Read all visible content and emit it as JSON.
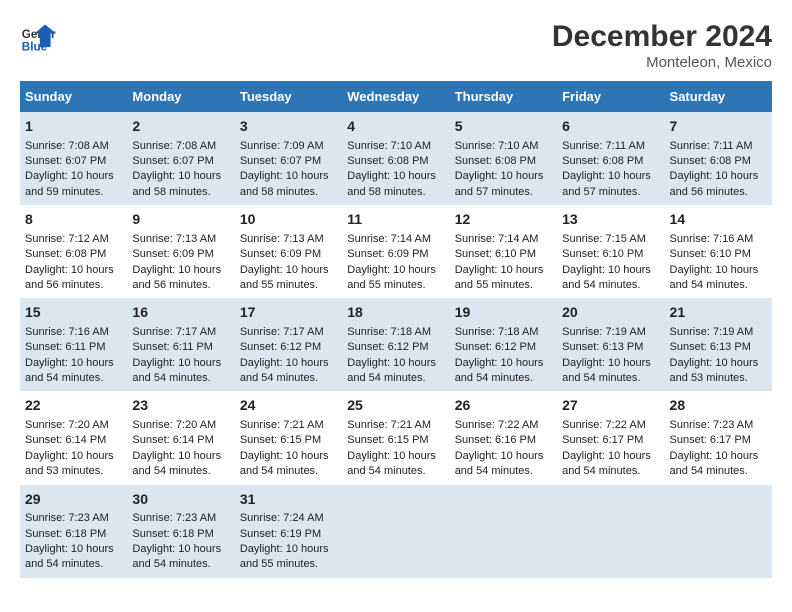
{
  "logo": {
    "line1": "General",
    "line2": "Blue"
  },
  "title": "December 2024",
  "subtitle": "Monteleon, Mexico",
  "days_header": [
    "Sunday",
    "Monday",
    "Tuesday",
    "Wednesday",
    "Thursday",
    "Friday",
    "Saturday"
  ],
  "weeks": [
    [
      {
        "day": "1",
        "sunrise": "7:08 AM",
        "sunset": "6:07 PM",
        "daylight": "10 hours and 59 minutes."
      },
      {
        "day": "2",
        "sunrise": "7:08 AM",
        "sunset": "6:07 PM",
        "daylight": "10 hours and 58 minutes."
      },
      {
        "day": "3",
        "sunrise": "7:09 AM",
        "sunset": "6:07 PM",
        "daylight": "10 hours and 58 minutes."
      },
      {
        "day": "4",
        "sunrise": "7:10 AM",
        "sunset": "6:08 PM",
        "daylight": "10 hours and 58 minutes."
      },
      {
        "day": "5",
        "sunrise": "7:10 AM",
        "sunset": "6:08 PM",
        "daylight": "10 hours and 57 minutes."
      },
      {
        "day": "6",
        "sunrise": "7:11 AM",
        "sunset": "6:08 PM",
        "daylight": "10 hours and 57 minutes."
      },
      {
        "day": "7",
        "sunrise": "7:11 AM",
        "sunset": "6:08 PM",
        "daylight": "10 hours and 56 minutes."
      }
    ],
    [
      {
        "day": "8",
        "sunrise": "7:12 AM",
        "sunset": "6:08 PM",
        "daylight": "10 hours and 56 minutes."
      },
      {
        "day": "9",
        "sunrise": "7:13 AM",
        "sunset": "6:09 PM",
        "daylight": "10 hours and 56 minutes."
      },
      {
        "day": "10",
        "sunrise": "7:13 AM",
        "sunset": "6:09 PM",
        "daylight": "10 hours and 55 minutes."
      },
      {
        "day": "11",
        "sunrise": "7:14 AM",
        "sunset": "6:09 PM",
        "daylight": "10 hours and 55 minutes."
      },
      {
        "day": "12",
        "sunrise": "7:14 AM",
        "sunset": "6:10 PM",
        "daylight": "10 hours and 55 minutes."
      },
      {
        "day": "13",
        "sunrise": "7:15 AM",
        "sunset": "6:10 PM",
        "daylight": "10 hours and 54 minutes."
      },
      {
        "day": "14",
        "sunrise": "7:16 AM",
        "sunset": "6:10 PM",
        "daylight": "10 hours and 54 minutes."
      }
    ],
    [
      {
        "day": "15",
        "sunrise": "7:16 AM",
        "sunset": "6:11 PM",
        "daylight": "10 hours and 54 minutes."
      },
      {
        "day": "16",
        "sunrise": "7:17 AM",
        "sunset": "6:11 PM",
        "daylight": "10 hours and 54 minutes."
      },
      {
        "day": "17",
        "sunrise": "7:17 AM",
        "sunset": "6:12 PM",
        "daylight": "10 hours and 54 minutes."
      },
      {
        "day": "18",
        "sunrise": "7:18 AM",
        "sunset": "6:12 PM",
        "daylight": "10 hours and 54 minutes."
      },
      {
        "day": "19",
        "sunrise": "7:18 AM",
        "sunset": "6:12 PM",
        "daylight": "10 hours and 54 minutes."
      },
      {
        "day": "20",
        "sunrise": "7:19 AM",
        "sunset": "6:13 PM",
        "daylight": "10 hours and 54 minutes."
      },
      {
        "day": "21",
        "sunrise": "7:19 AM",
        "sunset": "6:13 PM",
        "daylight": "10 hours and 53 minutes."
      }
    ],
    [
      {
        "day": "22",
        "sunrise": "7:20 AM",
        "sunset": "6:14 PM",
        "daylight": "10 hours and 53 minutes."
      },
      {
        "day": "23",
        "sunrise": "7:20 AM",
        "sunset": "6:14 PM",
        "daylight": "10 hours and 54 minutes."
      },
      {
        "day": "24",
        "sunrise": "7:21 AM",
        "sunset": "6:15 PM",
        "daylight": "10 hours and 54 minutes."
      },
      {
        "day": "25",
        "sunrise": "7:21 AM",
        "sunset": "6:15 PM",
        "daylight": "10 hours and 54 minutes."
      },
      {
        "day": "26",
        "sunrise": "7:22 AM",
        "sunset": "6:16 PM",
        "daylight": "10 hours and 54 minutes."
      },
      {
        "day": "27",
        "sunrise": "7:22 AM",
        "sunset": "6:17 PM",
        "daylight": "10 hours and 54 minutes."
      },
      {
        "day": "28",
        "sunrise": "7:23 AM",
        "sunset": "6:17 PM",
        "daylight": "10 hours and 54 minutes."
      }
    ],
    [
      {
        "day": "29",
        "sunrise": "7:23 AM",
        "sunset": "6:18 PM",
        "daylight": "10 hours and 54 minutes."
      },
      {
        "day": "30",
        "sunrise": "7:23 AM",
        "sunset": "6:18 PM",
        "daylight": "10 hours and 54 minutes."
      },
      {
        "day": "31",
        "sunrise": "7:24 AM",
        "sunset": "6:19 PM",
        "daylight": "10 hours and 55 minutes."
      },
      null,
      null,
      null,
      null
    ]
  ],
  "labels": {
    "sunrise": "Sunrise:",
    "sunset": "Sunset:",
    "daylight": "Daylight:"
  }
}
